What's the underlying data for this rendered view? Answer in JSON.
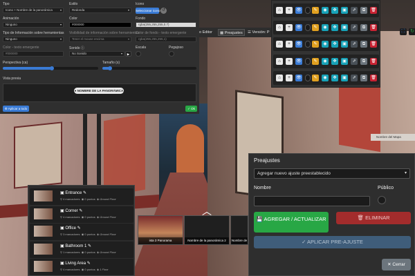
{
  "settings": {
    "tipo_label": "Tipo",
    "tipo_value": "Icono + Nombre de la panorámica",
    "estilo_label": "Estilo",
    "estilo_value": "Redonda",
    "icono_label": "Icono",
    "icono_button": "Seleccionar icono",
    "animacion_label": "Animación",
    "animacion_value": "Ninguno",
    "color_label": "Color",
    "color_value": "#000000",
    "fondo_label": "Fondo",
    "fondo_value": "rgba(255,255,255,0.7)",
    "tipo_info_label": "Tipo de Información sobre herramientas",
    "tipo_info_value": "Ninguno",
    "visibilidad_label": "Visibilidad de información sobre herramientas",
    "visibilidad_value": "Tener el mouse encima",
    "color_fondo_label": "Color de fondo - texto emergente",
    "color_fondo_value": "rgba(255,255,255,1)",
    "color_texto_label": "Color - texto emergente",
    "color_texto_value": "#000000",
    "sonido_label": "Sonido",
    "sonido_value": "No Sonido",
    "escala_label": "Escala",
    "pegajoso_label": "Pegajoso",
    "perspectiva_label": "Perspectiva (ca)",
    "tamano_label": "Tamaño (s)",
    "vista_previa_label": "Vista previa",
    "preview_pill": "NOMBRE DE LA PANORÁMICA",
    "apply_all": "Aplicar a todo",
    "ok": "Ok"
  },
  "toolbar": {
    "editor": "o Editor",
    "preajustes": "Preajustes",
    "version": "Versión: P"
  },
  "hotspot_rows": 5,
  "map_name": "Nombre del Mapa",
  "thumbnails": [
    {
      "caption": "ista 3 Panorama"
    },
    {
      "caption": "Nombre de la panorámica 2"
    },
    {
      "caption": "Nombre de"
    }
  ],
  "scenes": [
    {
      "title": "Entrance",
      "markers": "4 marcadores",
      "pois": "0 puntos",
      "floor": "Ground Floor"
    },
    {
      "title": "Corner",
      "markers": "4 marcadores",
      "pois": "0 puntos",
      "floor": "Ground Floor"
    },
    {
      "title": "Office",
      "markers": "3 marcadores",
      "pois": "0 puntos",
      "floor": "Ground Floor"
    },
    {
      "title": "Bathroom 1",
      "markers": "1 marcadores",
      "pois": "0 puntos",
      "floor": "Ground Floor"
    },
    {
      "title": "Living Area",
      "markers": "4 marcadores",
      "pois": "0 puntos",
      "floor": "1 Floor"
    }
  ],
  "presets": {
    "title": "Preajustes",
    "select_value": "Agregar nuevo ajuste preestablecido",
    "nombre_label": "Nombre",
    "publico_label": "Público",
    "nombre_value": "",
    "save_button": "AGREGAR / ACTUALIZAR",
    "delete_button": "ELIMINAR",
    "apply_button": "APLICAR PRE-AJUSTE",
    "close_button": "Cerrar"
  },
  "colors": {
    "accent_blue": "#3a7bd5",
    "ok_green": "#28a745",
    "save_green": "#28a745",
    "delete_red": "#a32c2c",
    "apply_blue": "#3f5d7a"
  }
}
